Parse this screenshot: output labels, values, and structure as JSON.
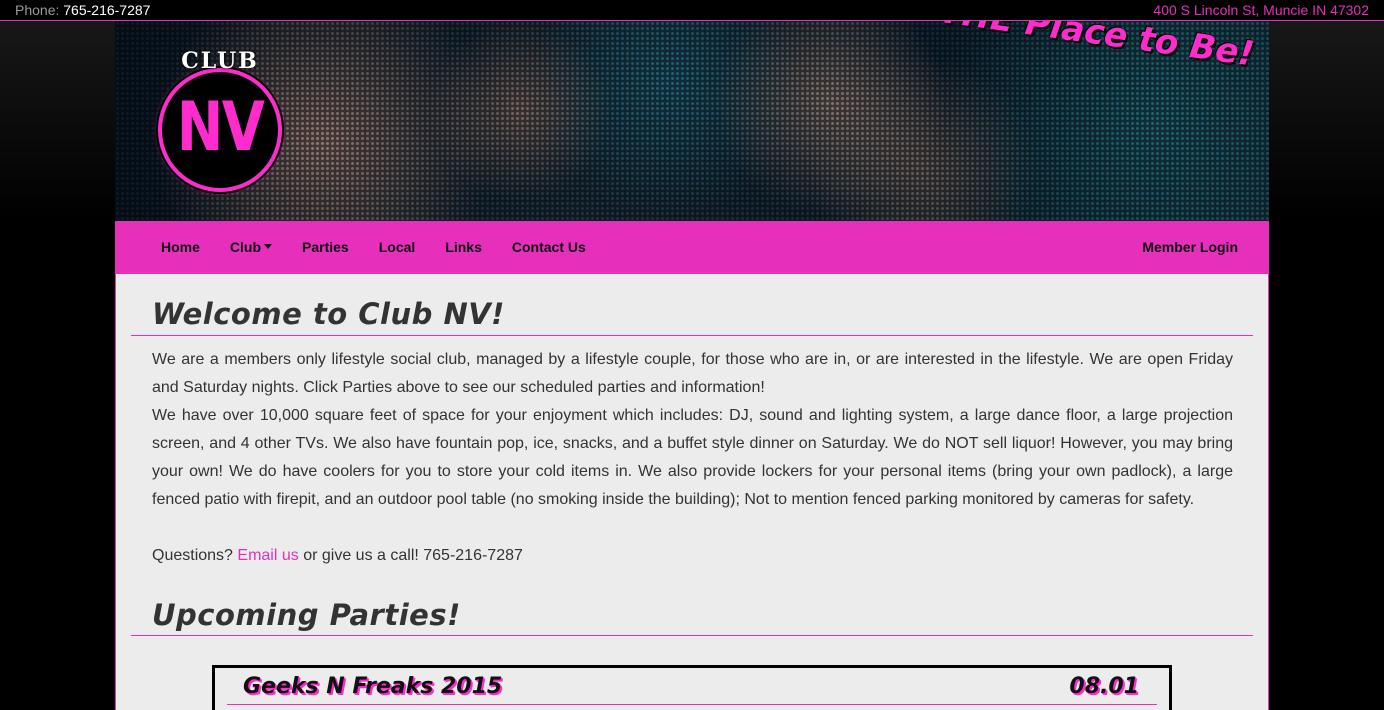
{
  "topbar": {
    "phone_label": "Phone:",
    "phone_number": "765-216-7287",
    "address": "400 S Lincoln St, Muncie IN 47302"
  },
  "banner": {
    "logo_club": "CLUB",
    "logo_nv": "NV",
    "tagline": "It's THE Place to Be!"
  },
  "nav": {
    "items": [
      {
        "label": "Home"
      },
      {
        "label": "Club"
      },
      {
        "label": "Parties"
      },
      {
        "label": "Local"
      },
      {
        "label": "Links"
      },
      {
        "label": "Contact Us"
      }
    ],
    "login": "Member Login"
  },
  "content": {
    "welcome_heading": "Welcome to Club NV!",
    "para1": "We are a members only lifestyle social club, managed by a lifestyle couple, for those who are in, or are interested in the lifestyle. We are open Friday and Saturday nights. Click Parties above to see our scheduled parties and information!",
    "para2": "We have over 10,000 square feet of space for your enjoyment which includes: DJ, sound and lighting system, a large dance floor, a large projection screen, and 4 other TVs. We also have fountain pop, ice, snacks, and a buffet style dinner on Saturday. We do NOT sell liquor! However, you may bring your own! We do have coolers for you to store your cold items in. We also provide lockers for your personal items (bring your own padlock), a large fenced patio with firepit, and an outdoor pool table (no smoking inside the building); Not to mention fenced parking monitored by cameras for safety.",
    "questions_prefix": "Questions?",
    "email_link": "Email us",
    "questions_suffix": "or give us a call! 765-216-7287",
    "parties_heading": "Upcoming Parties!"
  },
  "party": {
    "title": "Geeks N Freaks 2015",
    "date": "08.01"
  },
  "colors": {
    "accent": "#e62fbb",
    "background": "#000000",
    "content_bg": "#ececec"
  }
}
